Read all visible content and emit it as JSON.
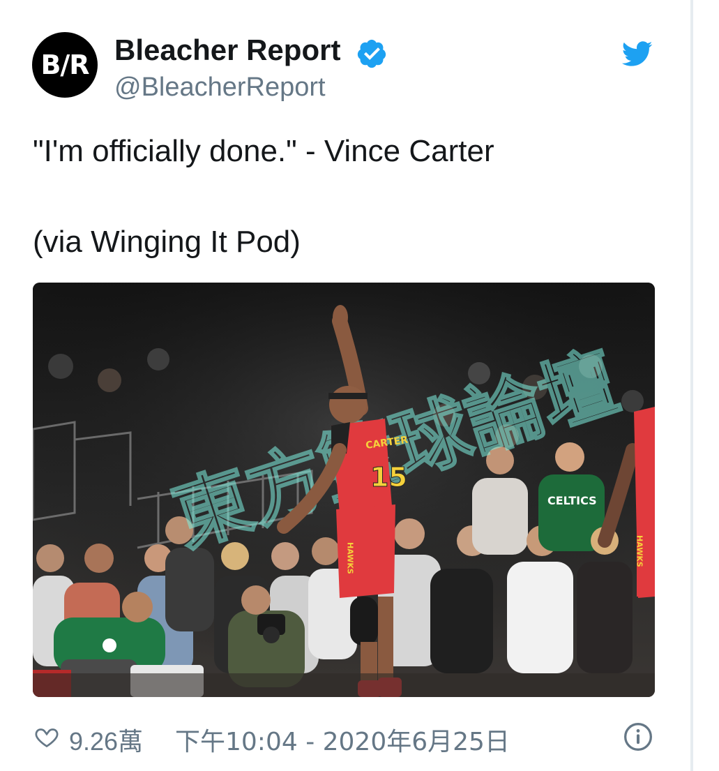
{
  "account": {
    "avatar_text": "B/R",
    "display_name": "Bleacher Report",
    "handle": "@BleacherReport",
    "verified": true
  },
  "tweet": {
    "line1": "\"I'm officially done.\" - Vince Carter",
    "line2": "(via Winging It Pod)"
  },
  "media": {
    "jersey_name": "CARTER",
    "jersey_number": "15",
    "team_label": "HAWKS",
    "crowd_shirt": "CELTICS",
    "watermark": "東方籃球論壇"
  },
  "footer": {
    "like_count": "9.26萬",
    "timestamp": "下午10:04 - 2020年6月25日"
  },
  "colors": {
    "brand_blue": "#1da1f2",
    "muted": "#657786",
    "hawks_red": "#e03a3e"
  },
  "icons": [
    "twitter-bird-icon",
    "verified-badge-icon",
    "heart-icon",
    "info-icon"
  ]
}
